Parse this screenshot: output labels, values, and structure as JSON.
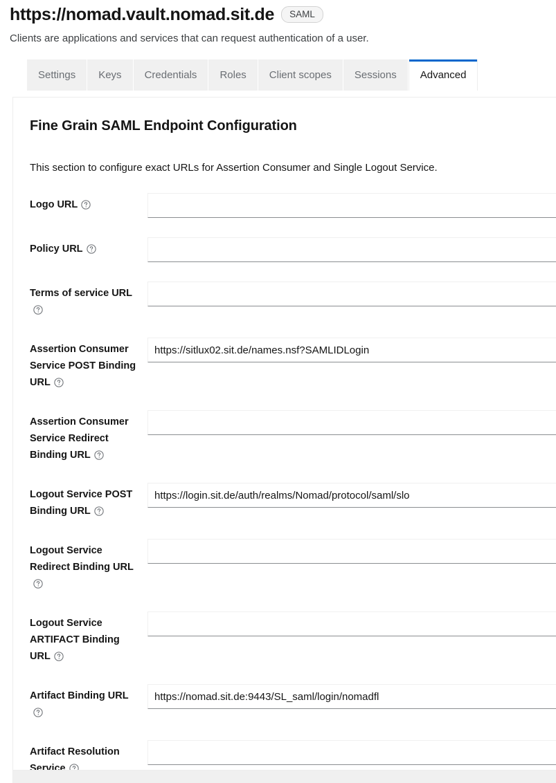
{
  "header": {
    "title": "https://nomad.vault.nomad.sit.de",
    "badge": "SAML",
    "subtitle": "Clients are applications and services that can request authentication of a user."
  },
  "tabs": [
    {
      "label": "Settings",
      "active": false
    },
    {
      "label": "Keys",
      "active": false
    },
    {
      "label": "Credentials",
      "active": false
    },
    {
      "label": "Roles",
      "active": false
    },
    {
      "label": "Client scopes",
      "active": false
    },
    {
      "label": "Sessions",
      "active": false
    },
    {
      "label": "Advanced",
      "active": true
    }
  ],
  "card": {
    "title": "Fine Grain SAML Endpoint Configuration",
    "description": "This section to configure exact URLs for Assertion Consumer and Single Logout Service.",
    "help_icon": "help-circle-icon"
  },
  "fields": [
    {
      "label": "Logo URL",
      "value": "",
      "placeholder": ""
    },
    {
      "label": "Policy URL",
      "value": "",
      "placeholder": ""
    },
    {
      "label": "Terms of service URL",
      "value": "",
      "placeholder": ""
    },
    {
      "label": "Assertion Consumer Service POST Binding URL",
      "value": "https://sitlux02.sit.de/names.nsf?SAMLIDLogin",
      "placeholder": ""
    },
    {
      "label": "Assertion Consumer Service Redirect Binding URL",
      "value": "",
      "placeholder": ""
    },
    {
      "label": "Logout Service POST Binding URL",
      "value": "https://login.sit.de/auth/realms/Nomad/protocol/saml/slo",
      "placeholder": ""
    },
    {
      "label": "Logout Service Redirect Binding URL",
      "value": "",
      "placeholder": ""
    },
    {
      "label": "Logout Service ARTIFACT Binding URL",
      "value": "",
      "placeholder": ""
    },
    {
      "label": "Artifact Binding URL",
      "value": "https://nomad.sit.de:9443/SL_saml/login/nomadfl",
      "placeholder": ""
    },
    {
      "label": "Artifact Resolution Service",
      "value": "",
      "placeholder": ""
    }
  ],
  "colors": {
    "accent": "#0066cc",
    "text": "#151515",
    "muted": "#6a6e73",
    "tab_inactive_bg": "#f0f0f0",
    "input_underline": "#8a8d90"
  }
}
